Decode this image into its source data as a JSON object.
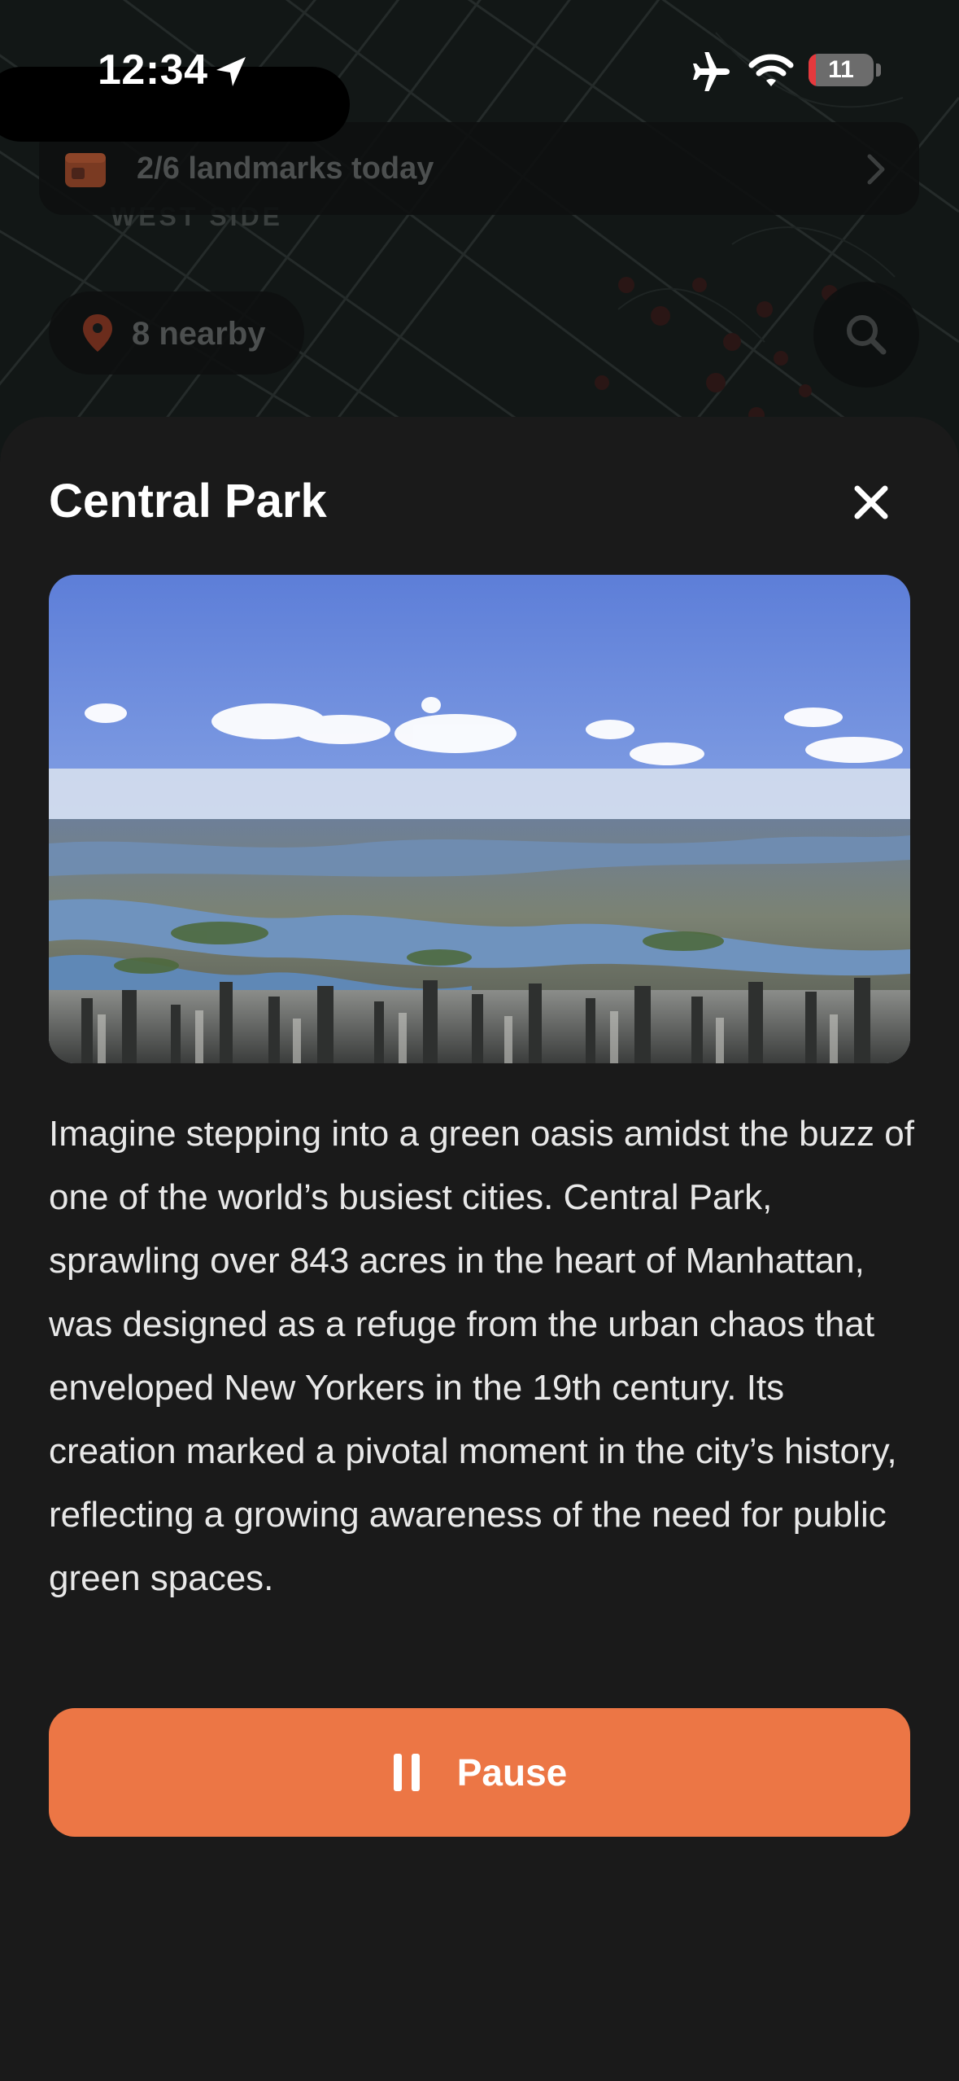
{
  "status_bar": {
    "time": "12:34",
    "battery_level": "11",
    "battery_fraction": 0.11
  },
  "map": {
    "landmarks_banner": "2/6 landmarks today",
    "area_label": "WEST SIDE",
    "nearby_chip": "8 nearby"
  },
  "sheet": {
    "title": "Central Park",
    "description": "Imagine stepping into a green oasis amidst the buzz of one of the world’s busiest cities. Central Park, sprawling over 843 acres in the heart of Manhattan, was designed as a refuge from the urban chaos that enveloped New Yorkers in the 19th century. Its creation marked a pivotal moment in the city’s history, reflecting a growing awareness of the need for public green spaces.",
    "pause_label": "Pause"
  },
  "colors": {
    "accent": "#ec7645",
    "sheet_background": "#1a1a1a",
    "battery_low": "#e5393d"
  },
  "icons": [
    "location-arrow-icon",
    "airplane-icon",
    "wifi-icon",
    "calendar-icon",
    "chevron-right-icon",
    "pin-icon",
    "search-icon",
    "close-icon",
    "pause-icon"
  ]
}
